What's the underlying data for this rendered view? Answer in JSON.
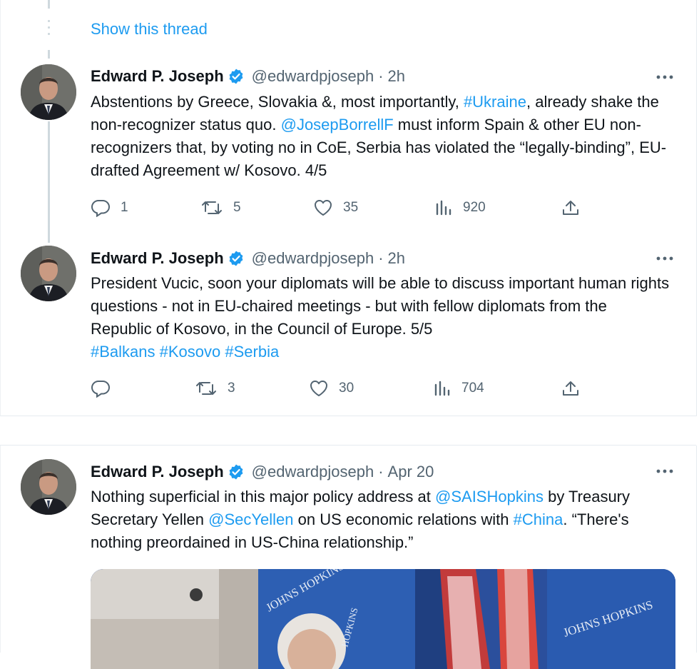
{
  "thread": {
    "show_thread_label": "Show this thread"
  },
  "tweets": [
    {
      "name": "Edward P. Joseph",
      "handle": "@edwardpjoseph",
      "separator": "·",
      "time": "2h",
      "segments": [
        "Abstentions by Greece, Slovakia &, most importantly, ",
        "#Ukraine",
        ", already shake the non-recognizer status quo. ",
        "@JosepBorrellF",
        " must inform Spain & other EU non-recognizers that, by voting no in CoE, Serbia has violated the “legally-binding”, EU-drafted Agreement w/ Kosovo. 4/5"
      ],
      "replies": "1",
      "retweets": "5",
      "likes": "35",
      "views": "920"
    },
    {
      "name": "Edward P. Joseph",
      "handle": "@edwardpjoseph",
      "separator": "·",
      "time": "2h",
      "segments": [
        "President Vucic, soon your diplomats will be able to discuss important human rights questions - not in EU-chaired meetings - but with fellow diplomats from the Republic of Kosovo, in the Council of Europe. 5/5",
        "#Balkans",
        " ",
        "#Kosovo",
        " ",
        "#Serbia"
      ],
      "replies": "",
      "retweets": "3",
      "likes": "30",
      "views": "704"
    },
    {
      "name": "Edward P. Joseph",
      "handle": "@edwardpjoseph",
      "separator": "·",
      "time": "Apr 20",
      "segments": [
        "Nothing superficial in this major policy address at ",
        "@SAISHopkins",
        " by Treasury Secretary Yellen ",
        "@SecYellen",
        " on US economic relations with ",
        "#China",
        ". “There's nothing preordained in US-China relationship.”"
      ],
      "media_sign_text": "JOHNS HOPKINS"
    }
  ],
  "colors": {
    "link": "#1d9bf0",
    "verified": "#1d9bf0",
    "muted": "#536471",
    "thread_line": "#cfd9de"
  },
  "icons": [
    "verified-icon",
    "more-icon",
    "reply-icon",
    "retweet-icon",
    "like-icon",
    "views-icon",
    "share-icon"
  ]
}
